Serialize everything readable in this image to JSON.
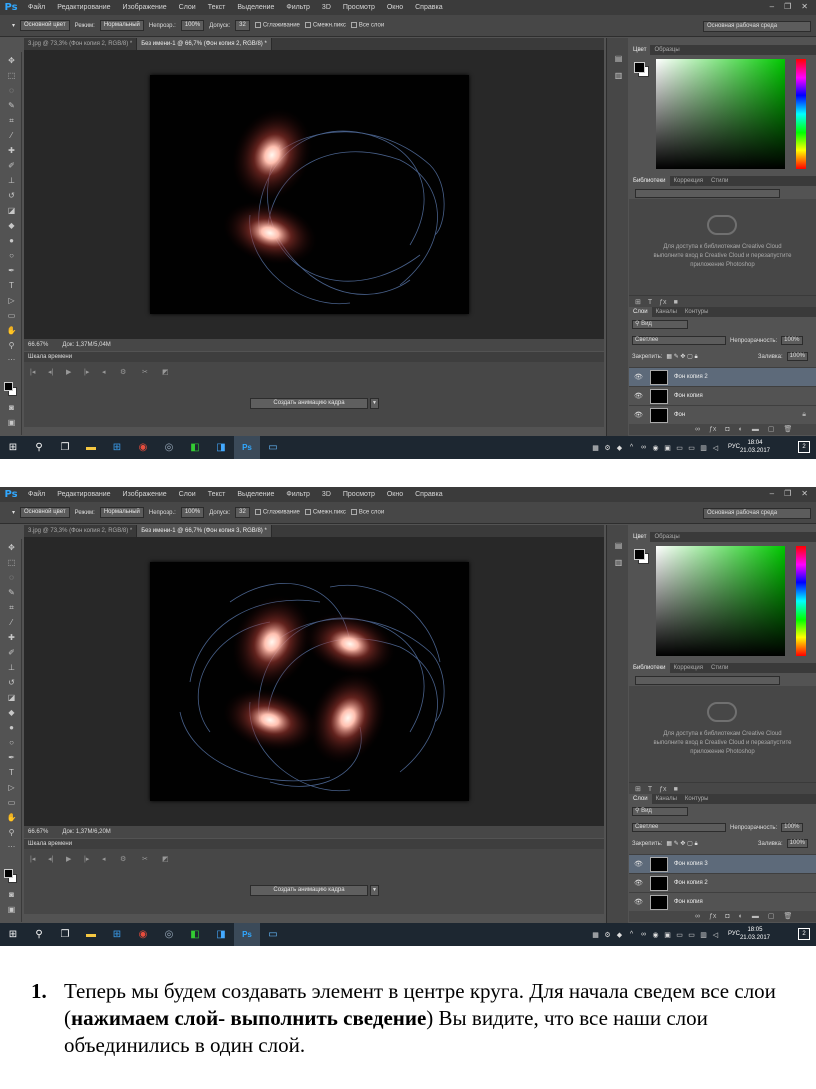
{
  "menu": [
    "Файл",
    "Редактирование",
    "Изображение",
    "Слои",
    "Текст",
    "Выделение",
    "Фильтр",
    "3D",
    "Просмотр",
    "Окно",
    "Справка"
  ],
  "app_logo": "Ps",
  "options_bar": {
    "fill_source": "Основной цвет",
    "mode_label": "Режим:",
    "mode_value": "Нормальный",
    "opacity_label": "Непрозр.:",
    "opacity_value": "100%",
    "tolerance_label": "Допуск:",
    "tolerance_value": "32",
    "antialias_label": "Сглаживание",
    "contiguous_label": "Смежн.пикс",
    "all_layers_label": "Все слои",
    "workspace": "Основная рабочая среда"
  },
  "panels": {
    "color_tab": "Цвет",
    "swatches_tab": "Образцы",
    "libraries_tab": "Библиотеки",
    "adjustments_tab": "Коррекция",
    "styles_tab": "Стили",
    "library_message": "Для доступа к библиотекам Creative Cloud выполните вход в Creative Cloud и перезапустите приложение Photoshop",
    "layers_tab": "Слои",
    "channels_tab": "Каналы",
    "paths_tab": "Контуры",
    "kind_filter": "Вид",
    "blend_mode": "Светлее",
    "opacity_label": "Непрозрачность:",
    "opacity_value": "100%",
    "lock_label": "Закрепить:",
    "fill_label": "Заливка:",
    "fill_value": "100%"
  },
  "timeline": {
    "title": "Шкала времени",
    "create_button": "Создать анимацию кадра"
  },
  "screenshot1": {
    "tabs": [
      "3.jpg @ 73,3% (Фон копия 2, RGB/8) *",
      "Без имени-1 @ 66,7% (Фон копия 2, RGB/8) *"
    ],
    "zoom": "66.67%",
    "doc_size": "Док: 1,37M/5,04M",
    "layers": [
      "Фон копия 2",
      "Фон копия",
      "Фон"
    ],
    "time": "18:04",
    "date": "21.03.2017",
    "lang": "РУС",
    "notifications": "2"
  },
  "screenshot2": {
    "tabs": [
      "3.jpg @ 73,3% (Фон копия 2, RGB/8) *",
      "Без имени-1 @ 66,7% (Фон копия 3, RGB/8) *"
    ],
    "zoom": "66.67%",
    "doc_size": "Док: 1,37M/6,20M",
    "layers": [
      "Фон копия 3",
      "Фон копия 2",
      "Фон копия"
    ],
    "time": "18:05",
    "date": "21.03.2017",
    "lang": "РУС",
    "notifications": "2"
  },
  "caption": {
    "number": "1.",
    "text_before": "Теперь мы будем создавать элемент в центре круга. Для начала сведем все слои (",
    "text_bold": "нажимаем слой- выполнить сведение",
    "text_after": ") Вы видите, что все наши слои объединились в один слой."
  }
}
